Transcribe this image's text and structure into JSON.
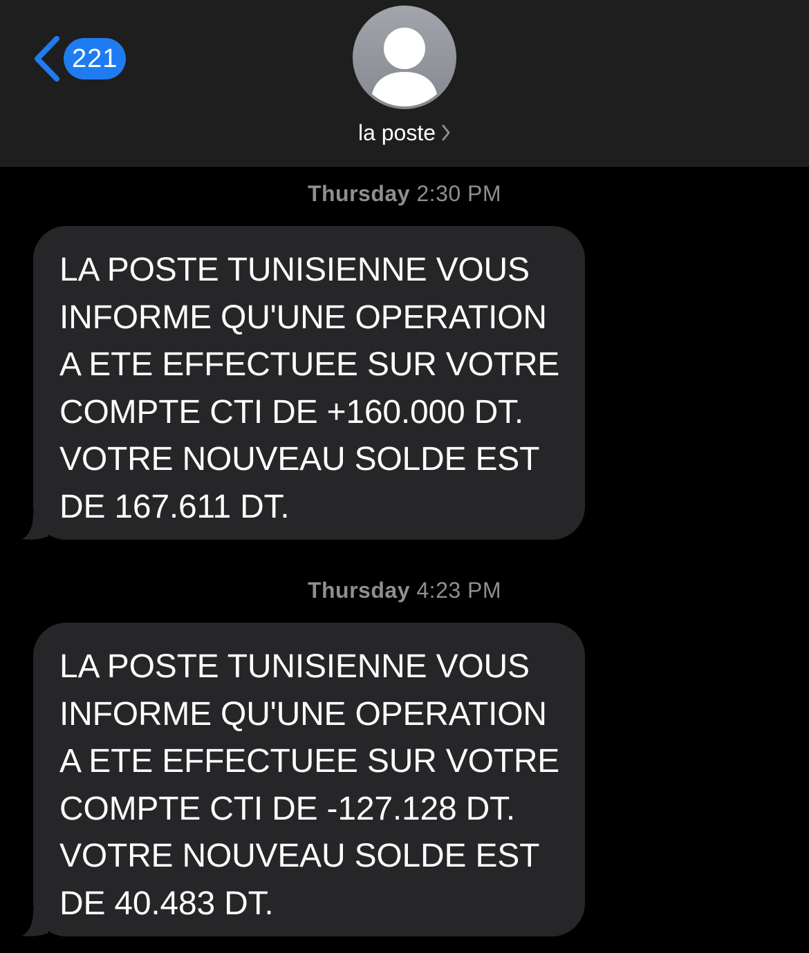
{
  "header": {
    "back_count": "221",
    "contact_name": "la poste",
    "icons": {
      "back": "chevron-left-icon",
      "avatar": "person-silhouette-icon",
      "details": "chevron-right-icon"
    },
    "colors": {
      "accent": "#1f7cf0",
      "header_bg": "#1e1e1e",
      "bubble_bg": "#262628",
      "timestamp": "#8e8e93"
    }
  },
  "messages": [
    {
      "time_day": "Thursday",
      "time_clock": "2:30 PM",
      "text": "LA POSTE TUNISIENNE VOUS\nINFORME QU'UNE OPERATION\nA ETE EFFECTUEE SUR VOTRE\nCOMPTE CTI DE +160.000 DT.\nVOTRE NOUVEAU SOLDE EST\nDE 167.611 DT."
    },
    {
      "time_day": "Thursday",
      "time_clock": "4:23 PM",
      "text": "LA POSTE TUNISIENNE VOUS\nINFORME QU'UNE OPERATION\nA ETE EFFECTUEE SUR VOTRE\nCOMPTE CTI DE -127.128 DT.\nVOTRE NOUVEAU SOLDE EST\nDE 40.483 DT."
    }
  ]
}
